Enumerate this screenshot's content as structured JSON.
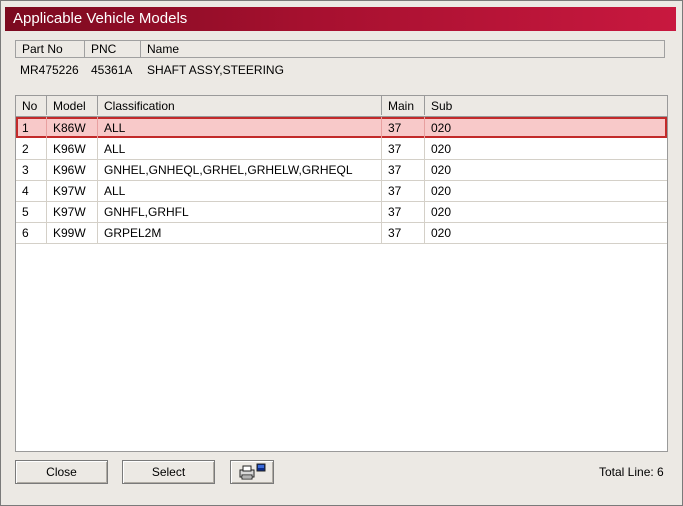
{
  "window": {
    "title": "Applicable Vehicle Models"
  },
  "part_info": {
    "headers": {
      "part_no": "Part No",
      "pnc": "PNC",
      "name": "Name"
    },
    "values": {
      "part_no": "MR475226",
      "pnc": "45361A",
      "name": "SHAFT ASSY,STEERING"
    }
  },
  "table": {
    "headers": {
      "no": "No",
      "model": "Model",
      "classification": "Classification",
      "main": "Main",
      "sub": "Sub"
    },
    "rows": [
      {
        "no": "1",
        "model": "K86W",
        "classification": "ALL",
        "main": "37",
        "sub": "020"
      },
      {
        "no": "2",
        "model": "K96W",
        "classification": "ALL",
        "main": "37",
        "sub": "020"
      },
      {
        "no": "3",
        "model": "K96W",
        "classification": "GNHEL,GNHEQL,GRHEL,GRHELW,GRHEQL",
        "main": "37",
        "sub": "020"
      },
      {
        "no": "4",
        "model": "K97W",
        "classification": "ALL",
        "main": "37",
        "sub": "020"
      },
      {
        "no": "5",
        "model": "K97W",
        "classification": "GNHFL,GRHFL",
        "main": "37",
        "sub": "020"
      },
      {
        "no": "6",
        "model": "K99W",
        "classification": "GRPEL2M",
        "main": "37",
        "sub": "020"
      }
    ],
    "selected_row": 1
  },
  "buttons": {
    "close": "Close",
    "select": "Select",
    "print_icon": "printer-icon"
  },
  "footer": {
    "total_line": "Total Line: 6"
  },
  "colors": {
    "title_bar": "#a6102f",
    "selected_row_bg": "#f8c9c9",
    "selected_row_border": "#c22a2a"
  }
}
